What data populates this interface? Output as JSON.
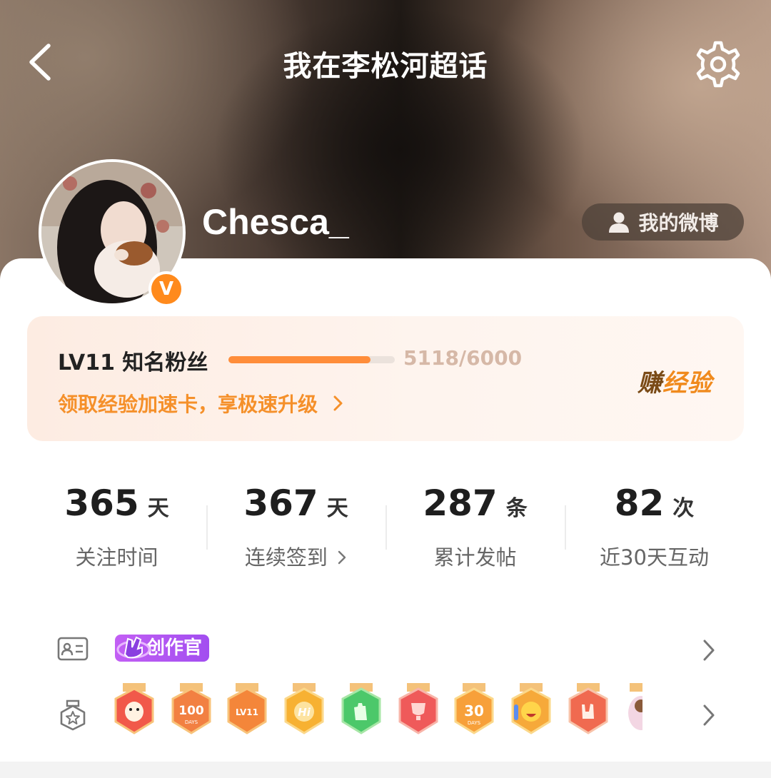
{
  "header": {
    "title": "我在李松河超话",
    "back_icon": "back-arrow-icon",
    "settings_icon": "gear-icon"
  },
  "profile": {
    "username": "Chesca_",
    "verified_badge": "V",
    "my_weibo_label": "我的微博"
  },
  "level": {
    "title": "LV11 知名粉丝",
    "progress": "5118/6000",
    "progress_fraction": 0.853,
    "boost_text": "领取经验加速卡，享极速升级",
    "earn_first": "赚",
    "earn_rest": "经验"
  },
  "stats": [
    {
      "value": "365",
      "unit": "天",
      "label": "关注时间"
    },
    {
      "value": "367",
      "unit": "天",
      "label": "连续签到"
    },
    {
      "value": "287",
      "unit": "条",
      "label": "累计发帖"
    },
    {
      "value": "82",
      "unit": "次",
      "label": "近30天互动"
    }
  ],
  "badges": {
    "creator_tag": "创作官",
    "medal_texts": [
      "100",
      "DAYS",
      "LV11",
      "Hi",
      "30",
      "DAYS"
    ]
  },
  "colors": {
    "accent_orange": "#ff8a1c",
    "progress_fill": "#ff8d3a",
    "creator_purple": "#b457f2"
  }
}
